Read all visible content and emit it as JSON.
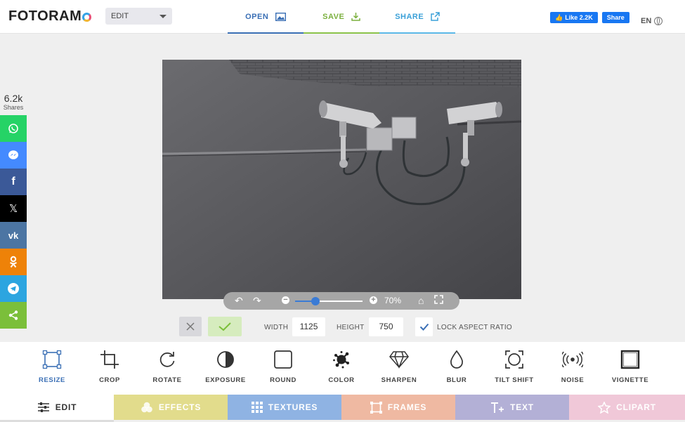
{
  "app": {
    "logo_text": "FOTORAM",
    "mode": "EDIT"
  },
  "topnav": {
    "open": "OPEN",
    "save": "SAVE",
    "share": "SHARE"
  },
  "facebook": {
    "like": "Like 2.2K",
    "share": "Share"
  },
  "language": "EN",
  "social": {
    "count": "6.2k",
    "count_label": "Shares",
    "buttons": [
      {
        "icon": "whatsapp-icon",
        "color": "#25d366"
      },
      {
        "icon": "messenger-icon",
        "color": "#448aff"
      },
      {
        "icon": "facebook-icon",
        "color": "#3b5998"
      },
      {
        "icon": "x-icon",
        "color": "#000000"
      },
      {
        "icon": "vk-icon",
        "color": "#4c75a3"
      },
      {
        "icon": "odnoklassniki-icon",
        "color": "#ee8208"
      },
      {
        "icon": "telegram-icon",
        "color": "#2ca5e0"
      },
      {
        "icon": "share-icon",
        "color": "#7bbf3a"
      }
    ]
  },
  "zoom": {
    "percent": "70%",
    "level": 0.3
  },
  "resize": {
    "width_label": "WIDTH",
    "width": "1125",
    "height_label": "HEIGHT",
    "height": "750",
    "lock_label": "LOCK ASPECT RATIO",
    "lock_checked": true
  },
  "tools": [
    {
      "label": "RESIZE",
      "icon": "resize-icon",
      "active": true
    },
    {
      "label": "CROP",
      "icon": "crop-icon"
    },
    {
      "label": "ROTATE",
      "icon": "rotate-icon"
    },
    {
      "label": "EXPOSURE",
      "icon": "exposure-icon"
    },
    {
      "label": "ROUND",
      "icon": "round-icon"
    },
    {
      "label": "COLOR",
      "icon": "color-splat-icon"
    },
    {
      "label": "SHARPEN",
      "icon": "diamond-icon"
    },
    {
      "label": "BLUR",
      "icon": "drop-icon"
    },
    {
      "label": "TILT SHIFT",
      "icon": "tilt-shift-icon"
    },
    {
      "label": "NOISE",
      "icon": "noise-icon"
    },
    {
      "label": "VIGNETTE",
      "icon": "vignette-icon"
    }
  ],
  "categories": [
    {
      "label": "EDIT",
      "color": "#ffffff",
      "icon": "sliders-icon"
    },
    {
      "label": "EFFECTS",
      "color": "#e2dc8c",
      "icon": "effects-icon"
    },
    {
      "label": "TEXTURES",
      "color": "#8fb3e3",
      "icon": "textures-icon"
    },
    {
      "label": "FRAMES",
      "color": "#efb9a2",
      "icon": "frames-icon"
    },
    {
      "label": "TEXT",
      "color": "#b3b0d6",
      "icon": "text-icon"
    },
    {
      "label": "CLIPART",
      "color": "#f0c8d8",
      "icon": "clipart-icon"
    }
  ]
}
